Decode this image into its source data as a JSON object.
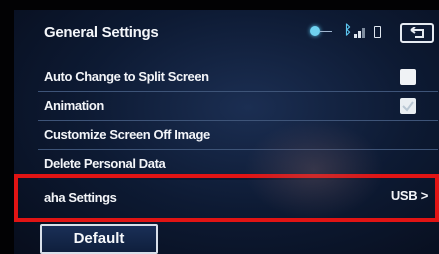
{
  "header": {
    "title": "General Settings"
  },
  "status_icons": [
    "gps-icon",
    "bluetooth-icon",
    "signal-icon",
    "battery-icon"
  ],
  "back_button_icon": "back-arrow-icon",
  "settings": [
    {
      "label": "Auto Change to Split Screen",
      "control": "checkbox",
      "checked": false
    },
    {
      "label": "Animation",
      "control": "checkbox",
      "checked": true
    },
    {
      "label": "Customize Screen Off Image",
      "control": "none"
    },
    {
      "label": "Delete Personal Data",
      "control": "none"
    },
    {
      "label": "aha Settings",
      "value": "USB >",
      "control": "value",
      "highlighted": true
    }
  ],
  "footer": {
    "default_label": "Default"
  },
  "colors": {
    "background": "#0d1a33",
    "highlight_border": "#e11414",
    "accent": "#5ec9f3"
  }
}
